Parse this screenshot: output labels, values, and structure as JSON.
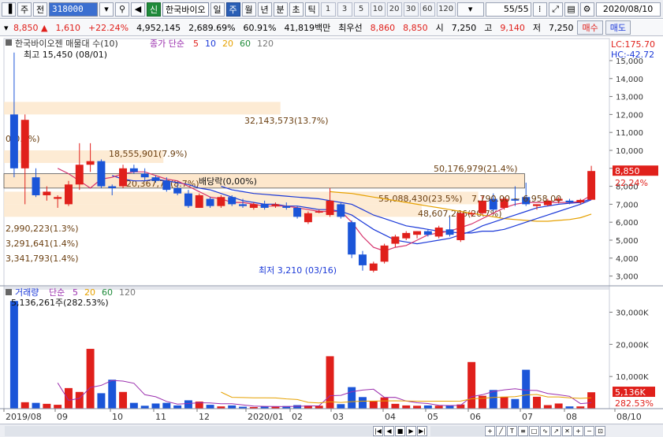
{
  "toolbar": {
    "market": "주",
    "market2": "전",
    "stock_code": "318000",
    "stock_name": "한국바이오",
    "badge": "신",
    "period_buttons": [
      "일",
      "주",
      "월",
      "년",
      "분",
      "초",
      "틱"
    ],
    "active_period": "주",
    "numbers": [
      "1",
      "3",
      "5",
      "10",
      "20",
      "30",
      "60",
      "120"
    ],
    "page": "55/55",
    "date": "2020/08/10"
  },
  "quote": {
    "price": "8,850 ▲",
    "change": "1,610",
    "change_pct": "+22.24%",
    "volume": "4,952,145",
    "vol_ratio": "2,689.69%",
    "rate": "60.91%",
    "amount": "41,819백만",
    "label_best": "최우선",
    "ask": "8,860",
    "bid": "8,850",
    "open_label": "시",
    "open": "7,250",
    "high_label": "고",
    "high": "9,140",
    "low_label": "저",
    "low": "7,250",
    "buy": "매수",
    "sell": "매도"
  },
  "price_panel": {
    "title": "한국바이오젠 매물대 수(10)",
    "ma_label": "종가 단순",
    "ma_periods": [
      "5",
      "10",
      "20",
      "60",
      "120"
    ],
    "ma_colors": [
      "#e0201b",
      "#1b39d8",
      "#e6a100",
      "#1f8b3a",
      "#777777"
    ],
    "high_note": "최고 15,450 (08/01)",
    "low_note": "최저 3,210 (03/16)",
    "divnote": "배당락(0,00%)",
    "lc": "LC:175.70",
    "hc": "HC:-42.72",
    "price_tag": "8,850",
    "price_pct": "22.24%",
    "y_ticks": [
      "15,000",
      "14,000",
      "13,000",
      "12,000",
      "11,000",
      "10,000",
      "9,000",
      "8,000",
      "7,000",
      "6,000",
      "5,000",
      "4,000",
      "3,000"
    ],
    "profile_labels": [
      "32,143,573(13.7%)",
      "0(0.0%)",
      "18,555,901(7.9%)",
      "20,367,77(8.7%)",
      "50,176,979(21.4%)",
      "55,088,430(23.5%)",
      "48,607,266(20.7%)",
      "2,990,223(1.3%)",
      "3,291,641(1.4%)",
      "3,341,793(1.4%)"
    ],
    "range_note": "7,790.00 ~ 6,958.00"
  },
  "volume_panel": {
    "title": "거래량",
    "ma_label": "단순",
    "ma_periods": [
      "5",
      "20",
      "60",
      "120"
    ],
    "max_note": "5,136,261주(282.53%)",
    "y_ticks": [
      "30,000K",
      "20,000K",
      "10,000K"
    ],
    "vol_tag": "5,136K",
    "vol_pct": "282.53%"
  },
  "x_axis": [
    "2019/08",
    "09",
    "10",
    "11",
    "12",
    "2020/01",
    "02",
    "03",
    "04",
    "05",
    "06",
    "07",
    "08",
    "08/10"
  ],
  "chart_data": {
    "type": "candlestick",
    "ylim": [
      2500,
      15700
    ],
    "candles": [
      {
        "o": 12000,
        "h": 15450,
        "l": 8500,
        "c": 9000
      },
      {
        "o": 9000,
        "h": 12000,
        "l": 7000,
        "c": 11700
      },
      {
        "o": 8500,
        "h": 9000,
        "l": 7400,
        "c": 7500
      },
      {
        "o": 7500,
        "h": 8000,
        "l": 7200,
        "c": 7700
      },
      {
        "o": 7300,
        "h": 7500,
        "l": 6800,
        "c": 7400
      },
      {
        "o": 7000,
        "h": 8300,
        "l": 6900,
        "c": 8100
      },
      {
        "o": 8100,
        "h": 10400,
        "l": 7800,
        "c": 9200
      },
      {
        "o": 9200,
        "h": 10400,
        "l": 8800,
        "c": 9400
      },
      {
        "o": 9400,
        "h": 9500,
        "l": 7900,
        "c": 8000
      },
      {
        "o": 8000,
        "h": 8100,
        "l": 7500,
        "c": 7900
      },
      {
        "o": 8000,
        "h": 9200,
        "l": 7900,
        "c": 9000
      },
      {
        "o": 9000,
        "h": 9200,
        "l": 8700,
        "c": 8800
      },
      {
        "o": 8700,
        "h": 9000,
        "l": 8300,
        "c": 8500
      },
      {
        "o": 8500,
        "h": 8600,
        "l": 8200,
        "c": 8300
      },
      {
        "o": 8300,
        "h": 8500,
        "l": 7700,
        "c": 7800
      },
      {
        "o": 7900,
        "h": 8100,
        "l": 7500,
        "c": 7600
      },
      {
        "o": 7600,
        "h": 7800,
        "l": 6800,
        "c": 6900
      },
      {
        "o": 6800,
        "h": 7600,
        "l": 6800,
        "c": 7500
      },
      {
        "o": 7300,
        "h": 7400,
        "l": 6800,
        "c": 6900
      },
      {
        "o": 6900,
        "h": 7500,
        "l": 6800,
        "c": 7400
      },
      {
        "o": 7400,
        "h": 7500,
        "l": 6900,
        "c": 7000
      },
      {
        "o": 7000,
        "h": 7300,
        "l": 6800,
        "c": 6900
      },
      {
        "o": 6800,
        "h": 7100,
        "l": 6700,
        "c": 7000
      },
      {
        "o": 7000,
        "h": 7200,
        "l": 6700,
        "c": 6800
      },
      {
        "o": 6900,
        "h": 7100,
        "l": 6800,
        "c": 7000
      },
      {
        "o": 6900,
        "h": 7100,
        "l": 6700,
        "c": 6800
      },
      {
        "o": 6800,
        "h": 6900,
        "l": 6200,
        "c": 6300
      },
      {
        "o": 6000,
        "h": 6600,
        "l": 5900,
        "c": 6500
      },
      {
        "o": 6600,
        "h": 6700,
        "l": 6500,
        "c": 6600
      },
      {
        "o": 6400,
        "h": 7900,
        "l": 6300,
        "c": 7200
      },
      {
        "o": 7000,
        "h": 7100,
        "l": 6200,
        "c": 6300
      },
      {
        "o": 6000,
        "h": 6100,
        "l": 4000,
        "c": 4200
      },
      {
        "o": 4200,
        "h": 4400,
        "l": 3300,
        "c": 3600
      },
      {
        "o": 3300,
        "h": 3800,
        "l": 3210,
        "c": 3700
      },
      {
        "o": 3800,
        "h": 4800,
        "l": 3700,
        "c": 4700
      },
      {
        "o": 4800,
        "h": 5300,
        "l": 4600,
        "c": 5200
      },
      {
        "o": 5100,
        "h": 5500,
        "l": 5000,
        "c": 5400
      },
      {
        "o": 5300,
        "h": 5500,
        "l": 5100,
        "c": 5500
      },
      {
        "o": 5500,
        "h": 5600,
        "l": 5200,
        "c": 5300
      },
      {
        "o": 5200,
        "h": 5800,
        "l": 5100,
        "c": 5700
      },
      {
        "o": 5600,
        "h": 6300,
        "l": 5200,
        "c": 5300
      },
      {
        "o": 5000,
        "h": 6600,
        "l": 4900,
        "c": 6500
      },
      {
        "o": 6500,
        "h": 6600,
        "l": 6300,
        "c": 6500
      },
      {
        "o": 6500,
        "h": 7500,
        "l": 6400,
        "c": 7200
      },
      {
        "o": 7300,
        "h": 7600,
        "l": 6600,
        "c": 6700
      },
      {
        "o": 6800,
        "h": 7400,
        "l": 6700,
        "c": 7300
      },
      {
        "o": 7300,
        "h": 8000,
        "l": 6900,
        "c": 7200
      },
      {
        "o": 7400,
        "h": 8200,
        "l": 6900,
        "c": 7000
      },
      {
        "o": 6900,
        "h": 7000,
        "l": 6700,
        "c": 7000
      },
      {
        "o": 6950,
        "h": 7300,
        "l": 6900,
        "c": 7200
      },
      {
        "o": 7200,
        "h": 7400,
        "l": 7050,
        "c": 7300
      },
      {
        "o": 7200,
        "h": 7300,
        "l": 7000,
        "c": 7100
      },
      {
        "o": 7100,
        "h": 7300,
        "l": 7000,
        "c": 7240
      },
      {
        "o": 7250,
        "h": 9140,
        "l": 7250,
        "c": 8850
      }
    ],
    "ma5": [
      null,
      null,
      null,
      null,
      9000,
      8700,
      8300,
      7900,
      8400,
      8500,
      8700,
      8800,
      8800,
      8600,
      8400,
      8300,
      8000,
      7700,
      7400,
      7300,
      7100,
      7100,
      7000,
      6900,
      6900,
      6900,
      6800,
      6700,
      6600,
      6600,
      6600,
      6000,
      5200,
      4600,
      4400,
      4600,
      4700,
      5000,
      5300,
      5400,
      5500,
      5700,
      5900,
      6200,
      6500,
      6800,
      7000,
      7100,
      7100,
      7100,
      7100,
      7100,
      7150,
      7500
    ],
    "ma10": [
      null,
      null,
      null,
      null,
      null,
      null,
      null,
      null,
      null,
      8600,
      8400,
      8300,
      8300,
      8400,
      8300,
      8200,
      8100,
      7900,
      7800,
      7600,
      7400,
      7200,
      7100,
      7000,
      7000,
      6900,
      6900,
      6800,
      6700,
      6700,
      6600,
      6400,
      6000,
      5600,
      5300,
      5000,
      4900,
      4800,
      4900,
      5000,
      5100,
      5300,
      5500,
      5800,
      6000,
      6200,
      6400,
      6600,
      6800,
      6900,
      7000,
      7050,
      7100,
      7300
    ],
    "ma20": [
      null,
      null,
      null,
      null,
      null,
      null,
      null,
      null,
      null,
      null,
      null,
      null,
      null,
      null,
      null,
      null,
      null,
      null,
      null,
      8000,
      7800,
      7700,
      7600,
      7550,
      7500,
      7450,
      7400,
      7350,
      7300,
      7200,
      7100,
      7000,
      6700,
      6400,
      6200,
      6000,
      5800,
      5700,
      5600,
      5500,
      5450,
      5400,
      5400,
      5500,
      5500,
      5600,
      5800,
      6000,
      6200,
      6400,
      6600,
      6800,
      7000,
      7250
    ],
    "ma60": [
      null,
      null,
      null,
      null,
      null,
      null,
      null,
      null,
      null,
      null,
      null,
      null,
      null,
      null,
      null,
      null,
      null,
      null,
      null,
      null,
      null,
      null,
      null,
      null,
      null,
      null,
      null,
      null,
      null,
      7700,
      7650,
      7600,
      7500,
      7400,
      7300,
      7200,
      7100,
      7000,
      6900,
      6800,
      6700,
      6600,
      6500,
      6400,
      6300,
      6200,
      6150,
      6100,
      6050,
      6050,
      6100,
      6150,
      6250,
      6450
    ],
    "volumes": [
      33500,
      2000,
      1800,
      1500,
      1200,
      6400,
      5200,
      18600,
      4800,
      9000,
      5200,
      1800,
      900,
      1600,
      1800,
      1000,
      2600,
      2200,
      1200,
      700,
      1000,
      600,
      500,
      700,
      600,
      800,
      1100,
      1000,
      900,
      16300,
      1400,
      6700,
      3600,
      2300,
      3500,
      1500,
      1000,
      900,
      1000,
      900,
      1000,
      1300,
      14500,
      4000,
      5800,
      3700,
      3000,
      12100,
      3700,
      1100,
      1600,
      700,
      700,
      5100
    ],
    "vol_ylim": [
      0,
      36000
    ],
    "profile": [
      {
        "price_lo": 12000,
        "price_hi": 12700,
        "share": 13.7,
        "label": "32,143,573(13.7%)"
      },
      {
        "price_lo": 9300,
        "price_hi": 10000,
        "share": 7.9,
        "label": "18,555,901(7.9%)"
      },
      {
        "price_lo": 7900,
        "price_hi": 8700,
        "share": 21.4,
        "label": "50,176,979(21.4%)"
      },
      {
        "price_lo": 7000,
        "price_hi": 7700,
        "share": 23.5,
        "label": "55,088,430(23.5%)"
      },
      {
        "price_lo": 6300,
        "price_hi": 7000,
        "share": 20.7,
        "label": "48,607,266(20.7%)"
      }
    ]
  }
}
